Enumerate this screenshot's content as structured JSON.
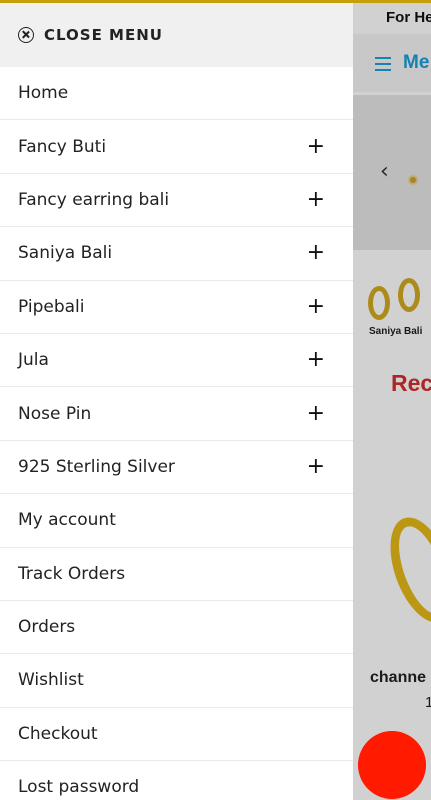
{
  "background_page": {
    "help_text": "For He",
    "menu_label": "Me",
    "slider_prev_glyph": "‹",
    "category_label": "Saniya Bali",
    "section_heading": "Rec",
    "product_name": "channe",
    "product_price": "1"
  },
  "drawer": {
    "close_label": "CLOSE MENU",
    "items": [
      {
        "label": "Home",
        "expandable": false
      },
      {
        "label": "Fancy Buti",
        "expandable": true
      },
      {
        "label": "Fancy earring bali",
        "expandable": true
      },
      {
        "label": "Saniya Bali",
        "expandable": true
      },
      {
        "label": "Pipebali",
        "expandable": true
      },
      {
        "label": "Jula",
        "expandable": true
      },
      {
        "label": "Nose Pin",
        "expandable": true
      },
      {
        "label": "925 Sterling Silver",
        "expandable": true
      },
      {
        "label": "My account",
        "expandable": false
      },
      {
        "label": "Track Orders",
        "expandable": false
      },
      {
        "label": "Orders",
        "expandable": false
      },
      {
        "label": "Wishlist",
        "expandable": false
      },
      {
        "label": "Checkout",
        "expandable": false
      },
      {
        "label": "Lost password",
        "expandable": false
      }
    ],
    "expand_glyph": "+"
  },
  "colors": {
    "accent_yellow": "#f2c40f",
    "brand_blue": "#1aa0d8",
    "heading_red": "#d32f2f",
    "fab_red": "#ff1a00"
  }
}
